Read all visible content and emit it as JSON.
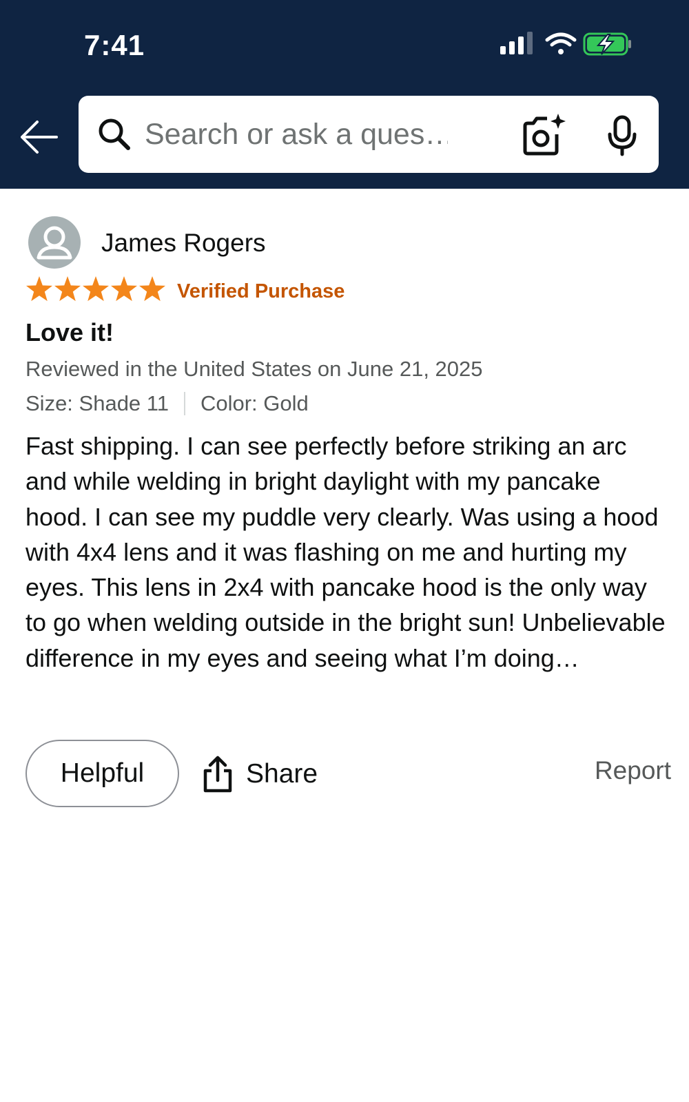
{
  "status_bar": {
    "time": "7:41",
    "icons": [
      "cellular-signal-icon",
      "wifi-icon",
      "battery-charging-icon"
    ],
    "battery_color": "#34c759"
  },
  "header": {
    "background_color": "#0f2442",
    "back_icon": "back-arrow-icon",
    "search": {
      "placeholder": "Search or ask a ques…",
      "value": "",
      "icons": [
        "search-icon",
        "camera-icon",
        "microphone-icon"
      ]
    }
  },
  "review": {
    "reviewer_name": "James Rogers",
    "rating": 5,
    "rating_max": 5,
    "star_color": "#f3861b",
    "verified_label": "Verified Purchase",
    "verified_color": "#c45500",
    "title": "Love it!",
    "date_line": "Reviewed in the United States on June 21, 2025",
    "size": "Size: Shade 11",
    "color": "Color: Gold",
    "body": "Fast shipping. I can see perfectly before striking an arc and while welding in bright daylight with my pancake hood. I can see my puddle very clearly. Was using a hood with 4x4 lens and it was flashing on me and hurting my eyes. This lens in 2x4 with pancake hood is the only way to go when welding outside in the bright sun! Unbelievable difference in my eyes and seeing what I’m doing…"
  },
  "actions": {
    "helpful_label": "Helpful",
    "share_label": "Share",
    "report_label": "Report"
  }
}
